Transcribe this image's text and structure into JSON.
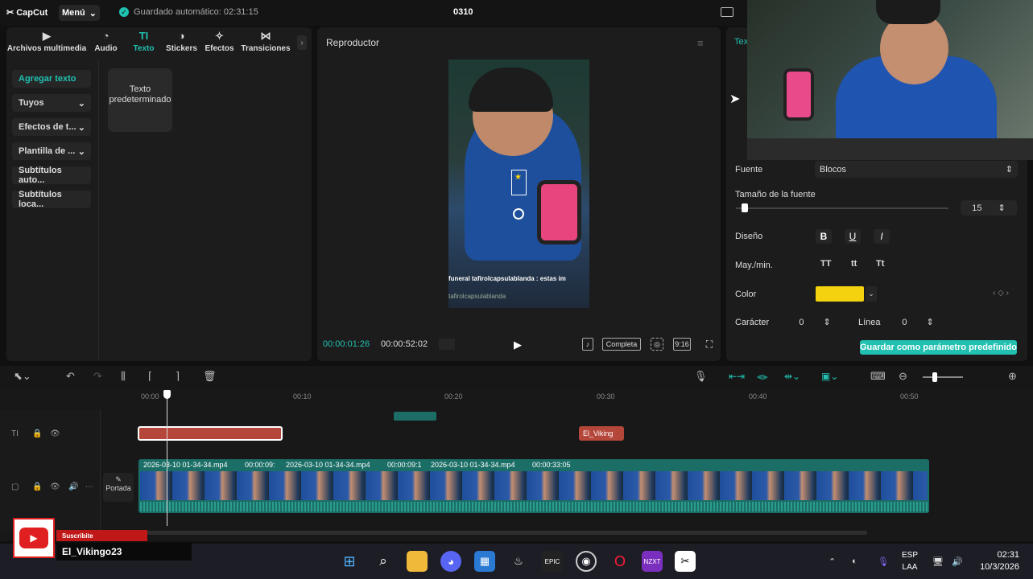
{
  "app": {
    "logo": "CapCut",
    "menu": "Menú",
    "autosave": "Guardado automático: 02:31:15",
    "project": "0310"
  },
  "tabs": [
    {
      "label": "Archivos multimedia",
      "icon": "media-icon"
    },
    {
      "label": "Audio",
      "icon": "audio-icon"
    },
    {
      "label": "Texto",
      "icon": "text-icon"
    },
    {
      "label": "Stickers",
      "icon": "sticker-icon"
    },
    {
      "label": "Efectos",
      "icon": "effects-icon"
    },
    {
      "label": "Transiciones",
      "icon": "transitions-icon"
    }
  ],
  "sidebar": [
    {
      "label": "Agregar texto"
    },
    {
      "label": "Tuyos"
    },
    {
      "label": "Efectos de t..."
    },
    {
      "label": "Plantilla de ..."
    },
    {
      "label": "Subtítulos auto..."
    },
    {
      "label": "Subtítulos loca..."
    }
  ],
  "text_card": "Texto predeterminado",
  "player": {
    "title": "Reproductor",
    "current": "00:00:01:26",
    "duration": "00:00:52:02",
    "full": "Completa",
    "ratio": "9:16",
    "chat1": "funeral  tafirolcapsulablanda : estas im",
    "chat2": "tafirolcapsulablanda"
  },
  "props": {
    "tab_partial": "Tex",
    "font_label": "Fuente",
    "font_value": "Blocos",
    "size_label": "Tamaño de la fuente",
    "size_value": "15",
    "size_fraction": 0.04,
    "design_label": "Diseño",
    "bold": "B",
    "underline": "U",
    "italic": "I",
    "case_label": "May./min.",
    "case_upper": "TT",
    "case_lower": "tt",
    "case_title": "Tt",
    "color_label": "Color",
    "color_value": "#f5d20f",
    "char_label": "Carácter",
    "char_value": "0",
    "line_label": "Línea",
    "line_value": "0",
    "save_preset": "Guardar como parámetro predefinido"
  },
  "timeline": {
    "ruler": [
      "00:00",
      "00:10",
      "00:20",
      "00:30",
      "00:40",
      "00:50"
    ],
    "text_clip2": "El_Viking",
    "clip1": "2026-03-10 01-34-34.mp4",
    "dur1": "00:00:09:",
    "clip2": "2026-03-10 01-34-34.mp4",
    "dur2": "00:00:09:1",
    "clip3": "2026-03-10 01-34-34.mp4",
    "dur3": "00:00:33:05",
    "portada": "Portada"
  },
  "overlay": {
    "subscribe": "Suscribite",
    "channel": "El_Vikingo23"
  },
  "taskbar": {
    "lang1": "ESP",
    "lang2": "LAA",
    "time": "02:31",
    "date": "10/3/2026"
  }
}
